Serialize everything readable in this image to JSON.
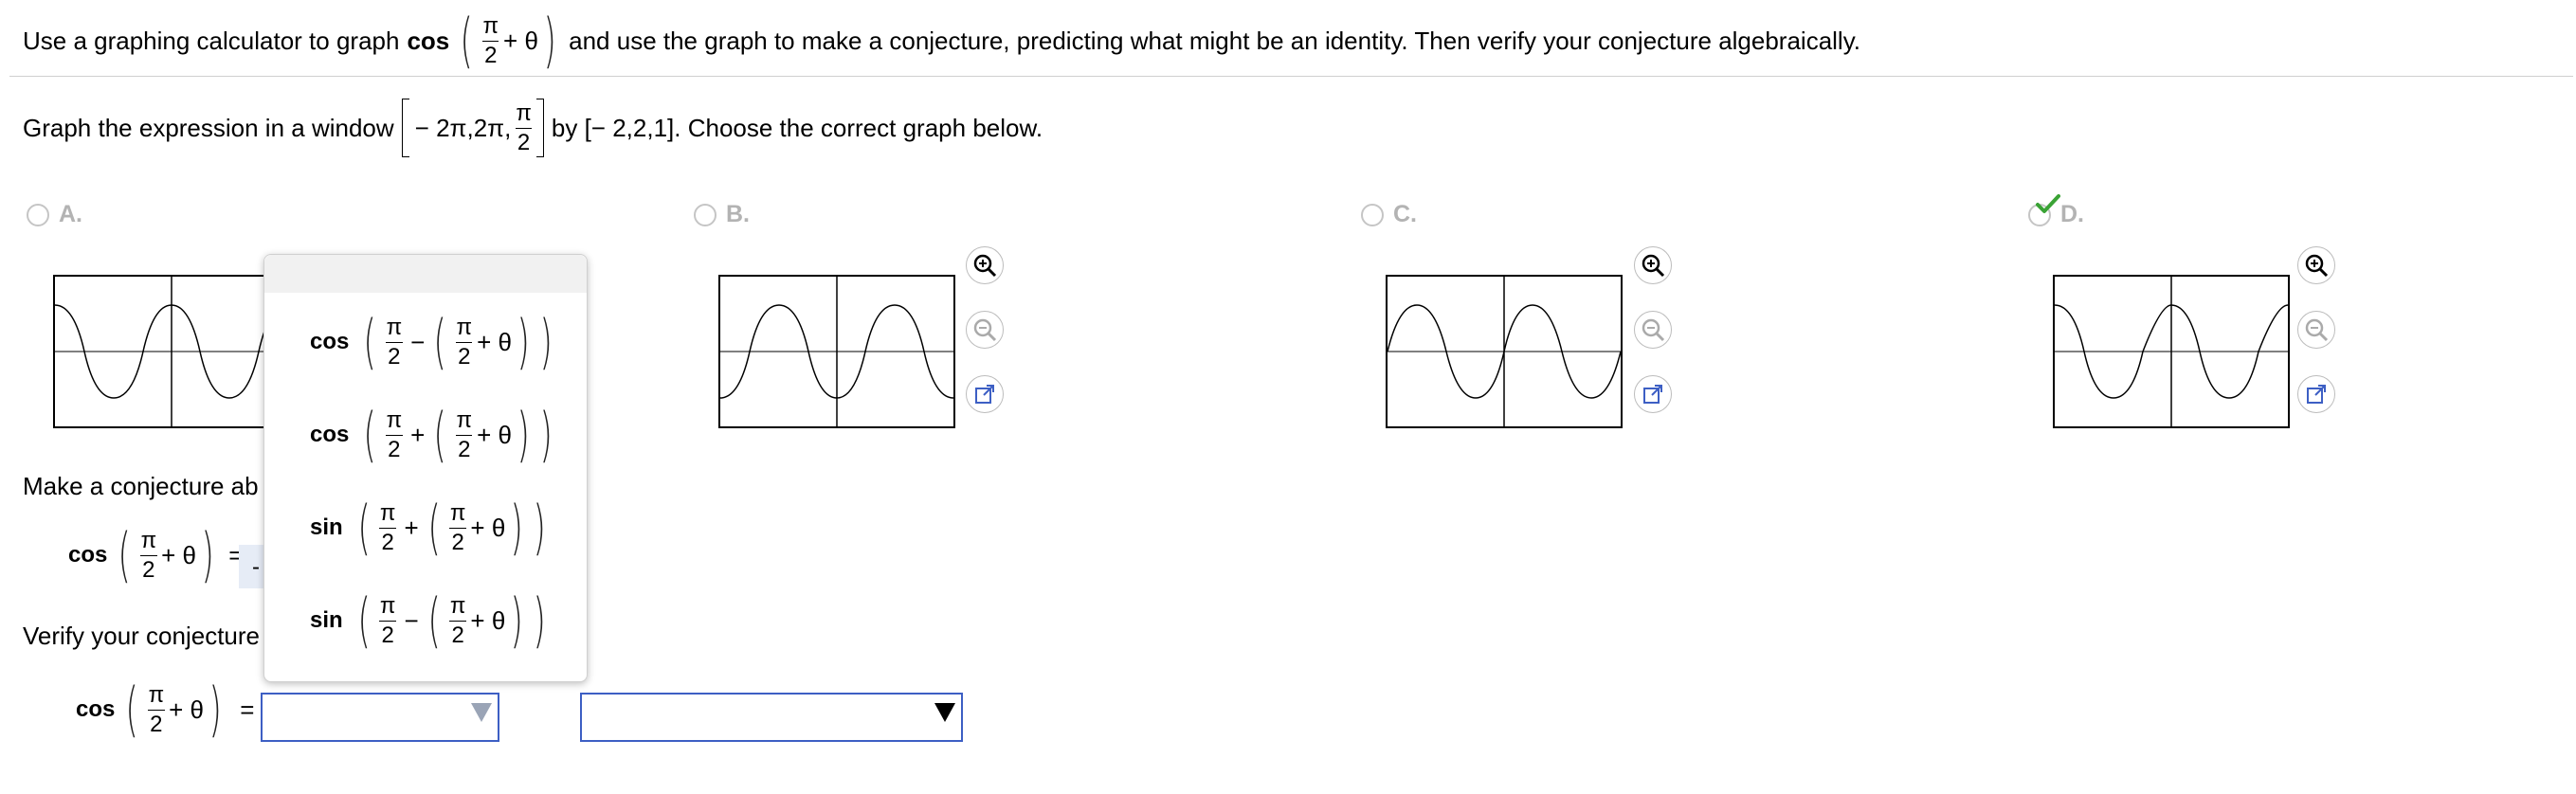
{
  "question": {
    "prefix": "Use a graphing calculator to graph",
    "fn": "cos",
    "pi": "π",
    "two": "2",
    "plus_theta": "+ θ",
    "suffix": "and use the graph to make a conjecture, predicting what might be an identity. Then verify your conjecture algebraically."
  },
  "window_line": {
    "prefix": "Graph the expression in a window",
    "interval_start": "− 2π,2π,",
    "pi": "π",
    "two": "2",
    "suffix": "by [− 2,2,1]. Choose the correct graph below."
  },
  "options": [
    {
      "letter": "A."
    },
    {
      "letter": "B."
    },
    {
      "letter": "C."
    },
    {
      "letter": "D."
    }
  ],
  "conjecture": {
    "label": "Make a conjecture ab",
    "fn": "cos",
    "pi": "π",
    "two": "2",
    "plus_theta": "+ θ",
    "equals": "=",
    "answer_fragment": "-"
  },
  "verify": {
    "label": "Verify your conjecture",
    "fn": "cos",
    "pi": "π",
    "two": "2",
    "plus_theta": "+ θ",
    "equals": "="
  },
  "menu": {
    "items": [
      {
        "fn": "cos",
        "pi": "π",
        "two": "2",
        "op": "−",
        "plus_theta": "+ θ"
      },
      {
        "fn": "cos",
        "pi": "π",
        "two": "2",
        "op": "+",
        "plus_theta": "+ θ"
      },
      {
        "fn": "sin",
        "pi": "π",
        "two": "2",
        "op": "+",
        "plus_theta": "+ θ"
      },
      {
        "fn": "sin",
        "pi": "π",
        "two": "2",
        "op": "−",
        "plus_theta": "+ θ"
      }
    ]
  },
  "icons": {
    "zoom_in": "zoom-in-icon",
    "zoom_out": "zoom-out-icon",
    "popout": "popout-icon",
    "correct": "checkmark-icon"
  },
  "colors": {
    "accent_blue": "#3d5fc4",
    "check_green": "#3aa335",
    "muted": "#b3b3b3"
  }
}
